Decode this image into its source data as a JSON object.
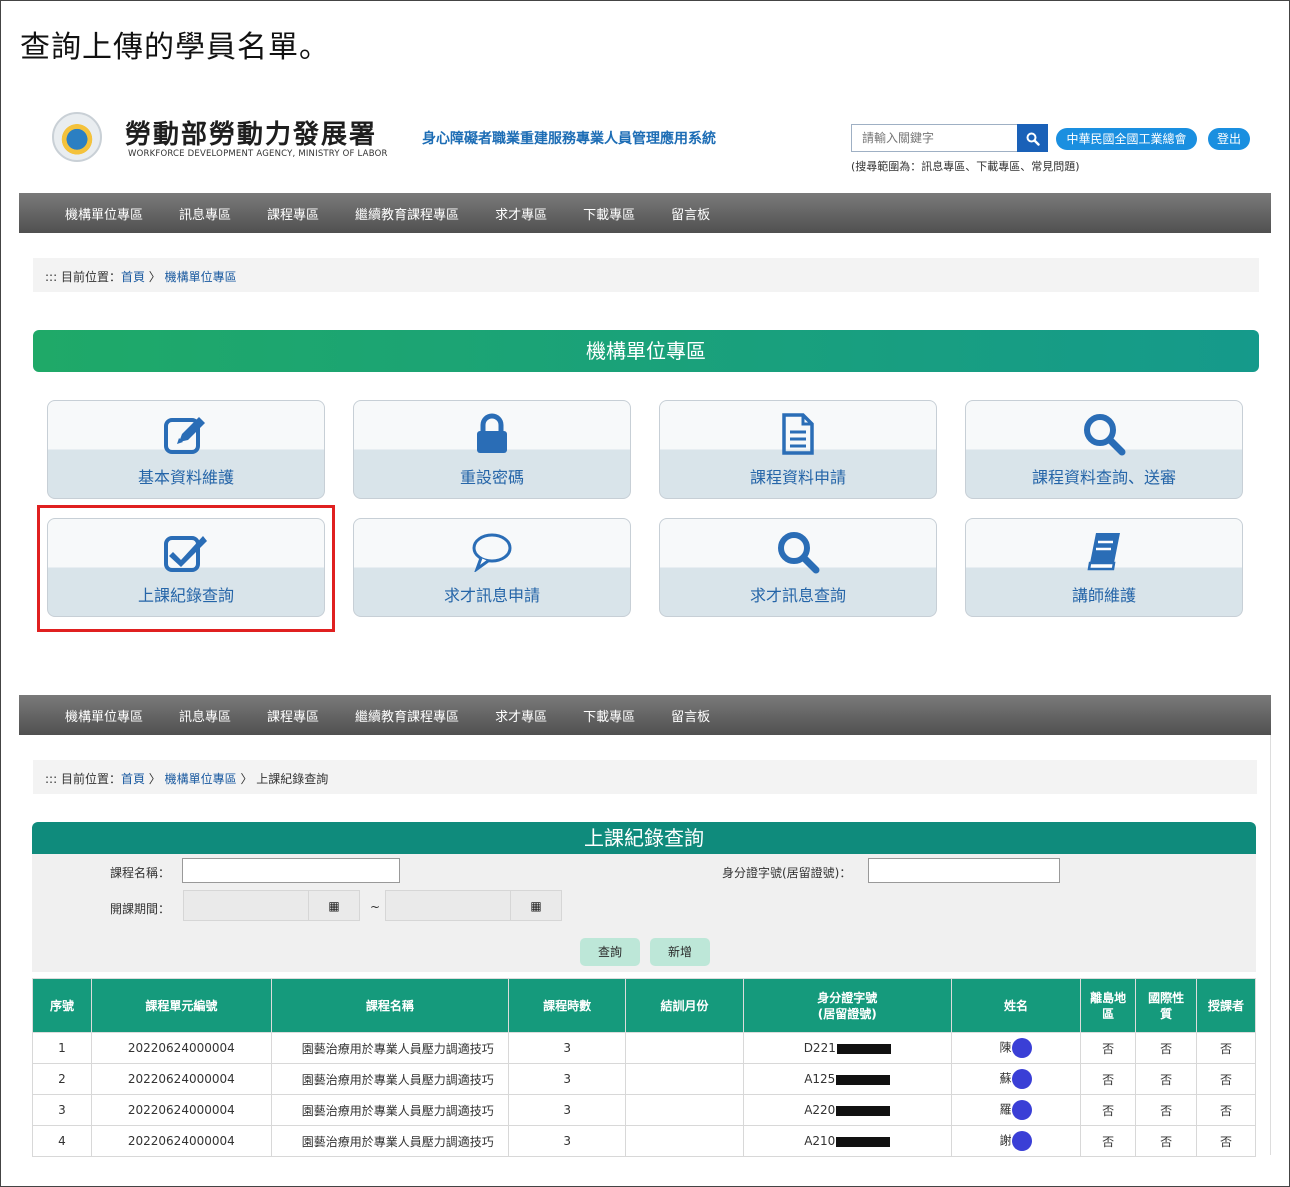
{
  "caption": "查詢上傳的學員名單。",
  "header": {
    "org_zh": "勞動部勞動力發展署",
    "org_en": "WORKFORCE DEVELOPMENT AGENCY, MINISTRY OF LABOR",
    "system_name": "身心障礙者職業重建服務專業人員管理應用系統",
    "search_placeholder": "請輸入關鍵字",
    "search_hint": "(搜尋範圍為：訊息專區、下載專區、常見問題)",
    "user_org": "中華民國全國工業總會",
    "logout": "登出"
  },
  "nav": [
    "機構單位專區",
    "訊息專區",
    "課程專區",
    "繼續教育課程專區",
    "求才專區",
    "下載專區",
    "留言板"
  ],
  "breadcrumb1": {
    "prefix": "::: 目前位置：",
    "home": "首頁",
    "sep": " 〉 ",
    "current": "機構單位專區"
  },
  "section_title": "機構單位專區",
  "cards": [
    {
      "label": "基本資料維護",
      "icon": "edit-icon"
    },
    {
      "label": "重設密碼",
      "icon": "lock-icon"
    },
    {
      "label": "課程資料申請",
      "icon": "document-icon"
    },
    {
      "label": "課程資料查詢、送審",
      "icon": "search-icon"
    },
    {
      "label": "上課紀錄查詢",
      "icon": "checkbox-icon"
    },
    {
      "label": "求才訊息申請",
      "icon": "speech-bubble-icon"
    },
    {
      "label": "求才訊息查詢",
      "icon": "search-icon"
    },
    {
      "label": "講師維護",
      "icon": "book-icon"
    }
  ],
  "breadcrumb2": {
    "prefix": "::: 目前位置：",
    "home": "首頁",
    "sep": " 〉 ",
    "mid": "機構單位專區",
    "current": "上課紀錄查詢"
  },
  "record_title": "上課紀錄查詢",
  "form": {
    "course_name_label": "課程名稱：",
    "id_label": "身分證字號(居留證號)：",
    "period_label": "開課期間：",
    "tilde": "~",
    "query": "查詢",
    "add": "新增"
  },
  "table": {
    "headers": [
      "序號",
      "課程單元編號",
      "課程名稱",
      "課程時數",
      "結訓月份",
      "身分證字號\n(居留證號)",
      "姓名",
      "離島地\n區",
      "國際性\n質",
      "授課者"
    ],
    "rows": [
      [
        "1",
        "20220624000004",
        "園藝治療用於專業人員壓力調適技巧",
        "3",
        "",
        "D221",
        "陳",
        "否",
        "否",
        "否"
      ],
      [
        "2",
        "20220624000004",
        "園藝治療用於專業人員壓力調適技巧",
        "3",
        "",
        "A125",
        "蘇",
        "否",
        "否",
        "否"
      ],
      [
        "3",
        "20220624000004",
        "園藝治療用於專業人員壓力調適技巧",
        "3",
        "",
        "A220",
        "羅",
        "否",
        "否",
        "否"
      ],
      [
        "4",
        "20220624000004",
        "園藝治療用於專業人員壓力調適技巧",
        "3",
        "",
        "A210",
        "謝",
        "否",
        "否",
        "否"
      ]
    ]
  }
}
